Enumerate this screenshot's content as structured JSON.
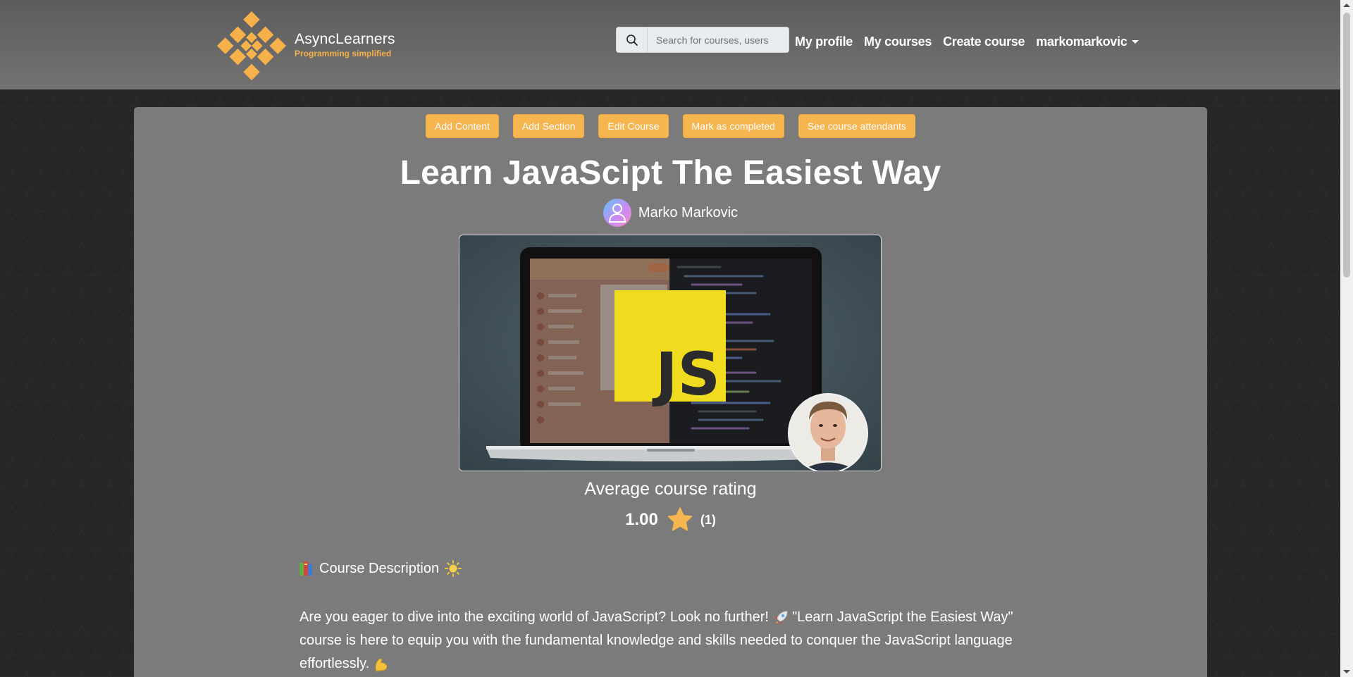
{
  "brand": {
    "name": "AsyncLearners",
    "tagline": "Programming simplified"
  },
  "search": {
    "placeholder": "Search for courses, users"
  },
  "nav": {
    "links": [
      "My profile",
      "My courses",
      "Create course"
    ],
    "user": "markomarkovic"
  },
  "actions": [
    "Add Content",
    "Add Section",
    "Edit Course",
    "Mark as completed",
    "See course attendants"
  ],
  "course": {
    "title": "Learn JavaScipt The Easiest Way",
    "author": "Marko Markovic",
    "image_badge": "JS",
    "rating_label": "Average course rating",
    "rating_value": "1.00",
    "rating_count": "(1)",
    "description_heading": "Course Description",
    "description_p1": "Are you eager to dive into the exciting world of JavaScript? Look no further!",
    "description_p2": "\"Learn JavaScript the Easiest Way\" course is here to equip you with the fundamental knowledge and skills needed to conquer the JavaScript language effortlessly."
  },
  "colors": {
    "accent": "#f7b550",
    "navbar": "#6b6b6b",
    "card": "#7b7b7b",
    "background": "#262626",
    "js_yellow": "#f0db1e"
  },
  "icons": {
    "search": "search-icon",
    "star": "star-icon",
    "book": "books-emoji",
    "sun": "sun-emoji",
    "rocket": "rocket-emoji",
    "muscle": "flexed-biceps-emoji"
  }
}
